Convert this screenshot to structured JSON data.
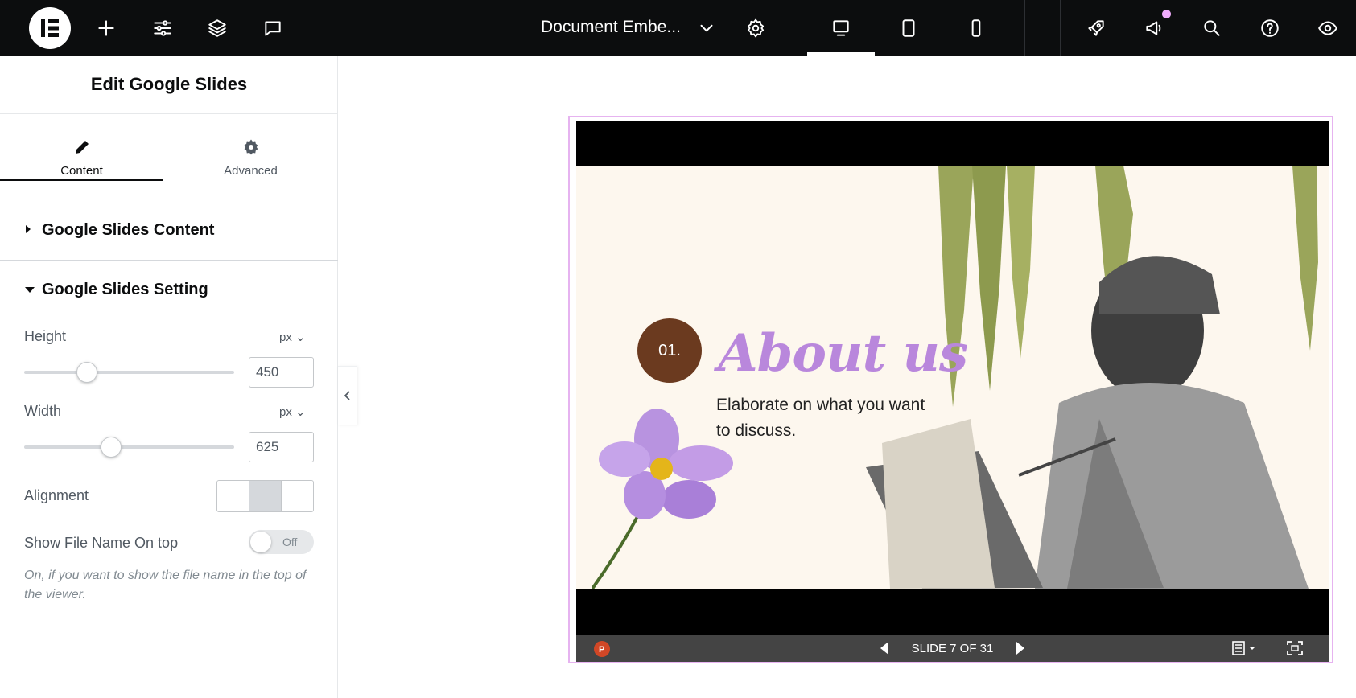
{
  "topbar": {
    "document_title": "Document Embe...",
    "icons": [
      "elementor-logo-icon",
      "add-icon",
      "site-settings-icon",
      "structure-layers-icon",
      "comments-icon",
      "chevron-down-icon",
      "page-settings-gear-icon",
      "desktop-icon",
      "tablet-icon",
      "mobile-icon",
      "publish-rocket-icon",
      "whats-new-megaphone-icon",
      "search-icon",
      "help-icon",
      "preview-eye-icon"
    ],
    "active_device": "desktop",
    "notification_dot_color": "#f0abfc"
  },
  "panel": {
    "title": "Edit Google Slides",
    "tabs": [
      {
        "label": "Content",
        "active": true
      },
      {
        "label": "Advanced",
        "active": false
      }
    ],
    "sections": {
      "content_title": "Google Slides Content",
      "setting_title": "Google Slides Setting"
    },
    "controls": {
      "height": {
        "label": "Height",
        "unit": "px",
        "value": "450",
        "slider_fraction": 0.3
      },
      "width": {
        "label": "Width",
        "unit": "px",
        "value": "625",
        "slider_fraction": 0.415
      },
      "alignment": {
        "label": "Alignment",
        "selected": "center"
      },
      "show_file_name": {
        "label": "Show File Name On top",
        "state": "Off",
        "hint": "On, if you want to show the file name in the top of the viewer."
      }
    }
  },
  "viewer": {
    "slide": {
      "number_badge": "01.",
      "heading": "About us",
      "body": "Elaborate on what you want to discuss."
    },
    "counter": "SLIDE 7 OF 31",
    "accent_border_color": "#e6b3f0"
  }
}
